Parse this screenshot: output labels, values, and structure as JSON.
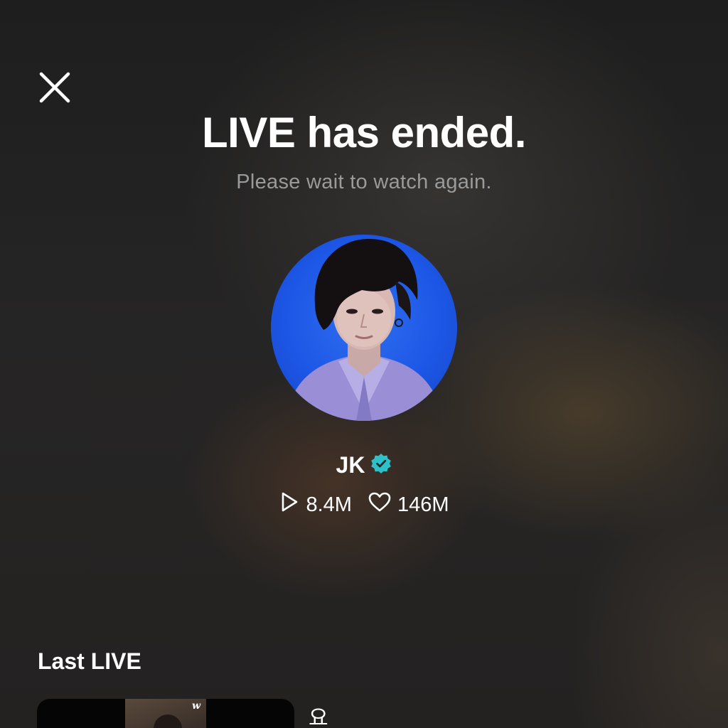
{
  "header": {
    "close_icon": "close-icon",
    "title": "LIVE has ended.",
    "subtitle": "Please wait to watch again."
  },
  "profile": {
    "name": "JK",
    "verified_icon": "verified-badge-icon",
    "verified_color": "#2fc1c9",
    "avatar_background_color": "#1d57e6",
    "stats": {
      "plays_icon": "play-icon",
      "plays": "8.4M",
      "likes_icon": "heart-icon",
      "likes": "146M"
    }
  },
  "last_live": {
    "section_title": "Last LIVE",
    "items": [
      {
        "thumbnail_mark": "w",
        "title": "요"
      }
    ]
  }
}
